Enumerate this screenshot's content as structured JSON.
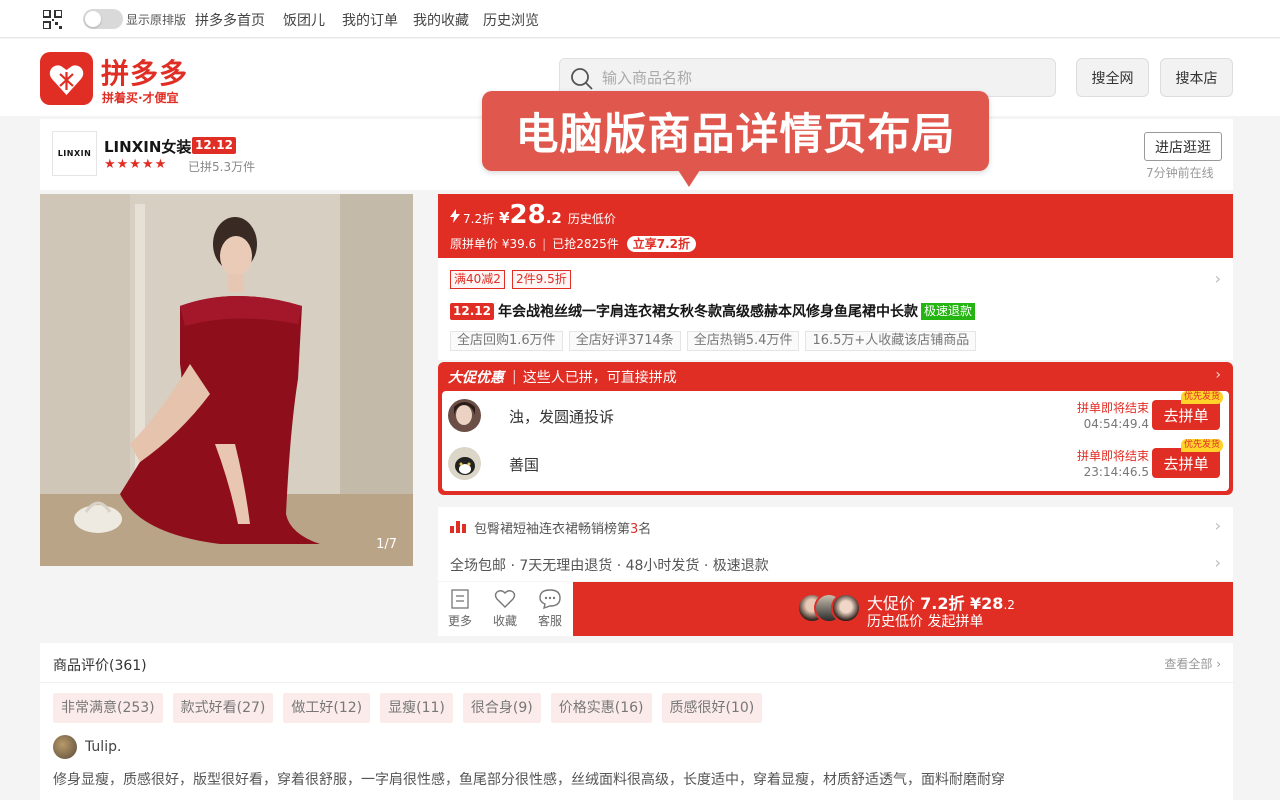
{
  "topbar": {
    "toggle_label": "显示原排版",
    "nav": [
      "拼多多首页",
      "饭团儿",
      "我的订单",
      "我的收藏",
      "历史浏览"
    ]
  },
  "header": {
    "logo_text": "拼多多",
    "logo_slogan": "拼着买·才便宜",
    "search_placeholder": "输入商品名称",
    "search_all": "搜全网",
    "search_shop": "搜本店"
  },
  "shop": {
    "logo_text": "LINXIN",
    "name": "LINXIN女装",
    "badge": "12.12",
    "stars": "★★★★★",
    "sold": "已拼5.3万件",
    "enter_button": "进店逛逛",
    "online": "7分钟前在线"
  },
  "callout": "电脑版商品详情页布局",
  "image": {
    "counter": "1/7"
  },
  "price": {
    "discount": "7.2折",
    "yen": "¥",
    "integer": "28",
    "decimal": ".2",
    "label": "历史低价",
    "original": "原拼单价 ¥39.6",
    "sold": "已抢2825件",
    "tag": "立享7.2折"
  },
  "product": {
    "coupons": [
      "满40减2",
      "2件9.5折"
    ],
    "title_badge": "12.12",
    "title": "年会战袍丝绒一字肩连衣裙女秋冬款高级感赫本风修身鱼尾裙中长款",
    "fast_refund": "极速退款",
    "stats": [
      "全店回购1.6万件",
      "全店好评3714条",
      "全店热销5.4万件",
      "16.5万+人收藏该店铺商品"
    ]
  },
  "promo": {
    "title": "大促优惠",
    "subtitle": "这些人已拼，可直接拼成",
    "groups": [
      {
        "name": "浊，发圆通投诉",
        "status": "拼单即将结束",
        "timer": "04:54:49.4",
        "button": "去拼单",
        "flag": "优先发货"
      },
      {
        "name": "善国",
        "status": "拼单即将结束",
        "timer": "23:14:46.5",
        "button": "去拼单",
        "flag": "优先发货"
      }
    ]
  },
  "rank": {
    "prefix": "包臀裙短袖连衣裙畅销榜第",
    "number": "3",
    "suffix": "名"
  },
  "service": "全场包邮 · 7天无理由退货 · 48小时发货 · 极速退款",
  "actions": {
    "more": "更多",
    "favorite": "收藏",
    "service": "客服",
    "buy_line1_prefix": "大促价",
    "buy_line1_price": "7.2折 ¥28",
    "buy_line1_decimal": ".2",
    "buy_line2": "历史低价 发起拼单"
  },
  "reviews": {
    "title": "商品评价(361)",
    "view_all": "查看全部",
    "tags": [
      "非常满意(253)",
      "款式好看(27)",
      "做工好(12)",
      "显瘦(11)",
      "很合身(9)",
      "价格实惠(16)",
      "质感很好(10)"
    ],
    "username": "Tulip.",
    "text": "修身显瘦，质感很好，版型很好看，穿着很舒服，一字肩很性感，鱼尾部分很性感，丝绒面料很高级，长度适中，穿着显瘦，材质舒适透气，面料耐磨耐穿"
  },
  "colors": {
    "brand_red": "#e02e24",
    "green": "#25b513",
    "callout": "#e0584d"
  }
}
